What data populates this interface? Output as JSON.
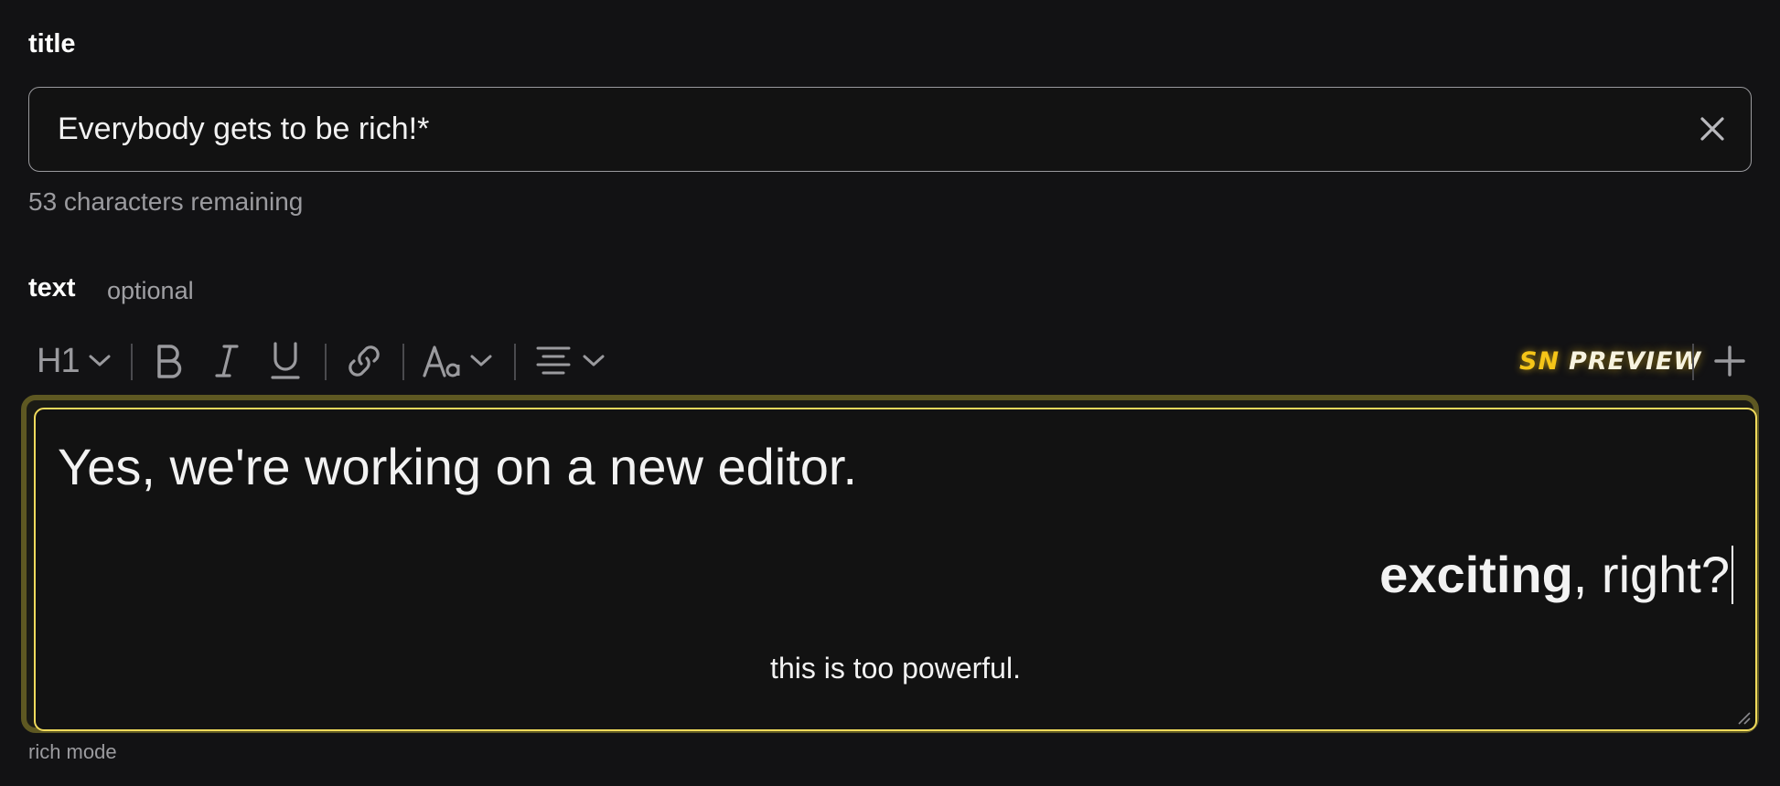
{
  "title_field": {
    "label": "title",
    "value": "Everybody gets to be rich!*",
    "remaining": "53 characters remaining"
  },
  "text_field": {
    "label": "text",
    "hint": "optional"
  },
  "toolbar": {
    "heading_label": "H1",
    "icons": [
      "heading-dropdown",
      "bold-icon",
      "italic-icon",
      "underline-icon",
      "link-icon",
      "font-size-icon",
      "align-icon",
      "plus-icon"
    ],
    "preview_prefix": "SN",
    "preview_label": "PREVIEW"
  },
  "editor": {
    "heading": "Yes, we're working on a new editor.",
    "right_bold": "exciting",
    "right_rest": ", right?",
    "center": "this is too powerful."
  },
  "footer": {
    "mode": "rich mode"
  },
  "colors": {
    "background": "#121214",
    "accent": "#f0da5c",
    "muted": "#9b9b9f"
  }
}
